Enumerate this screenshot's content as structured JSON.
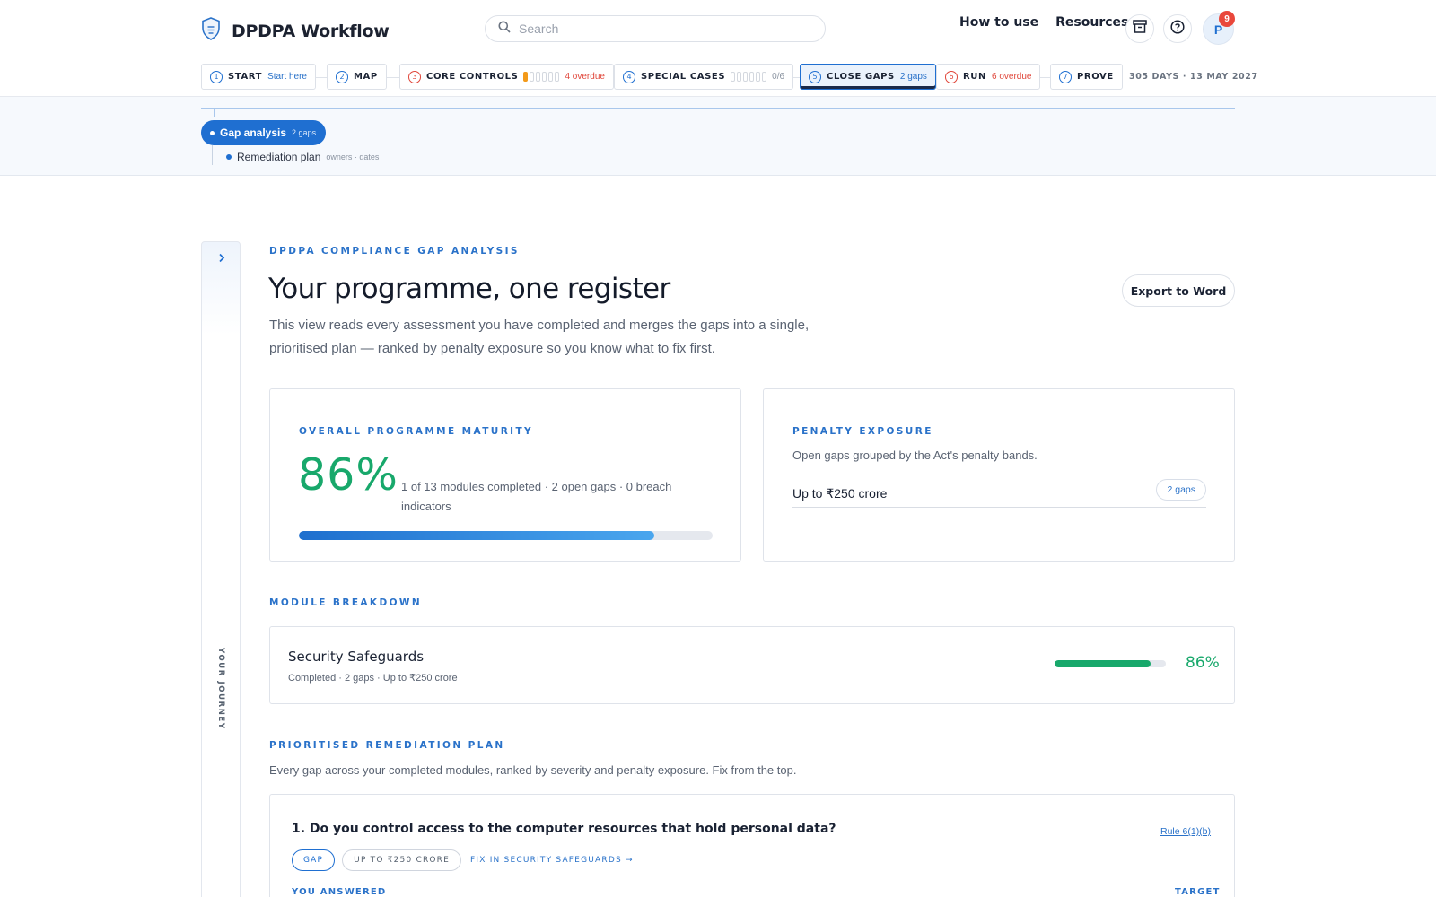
{
  "app": {
    "title": "DPDPA Workflow"
  },
  "search": {
    "placeholder": "Search"
  },
  "nav": {
    "how_to_use": "How to use",
    "resources": "Resources",
    "avatar_initial": "P",
    "notification_count": "9"
  },
  "stepper": {
    "steps": [
      {
        "num": "1",
        "title": "START",
        "sub": "Start here"
      },
      {
        "num": "2",
        "title": "MAP",
        "sub": ""
      },
      {
        "num": "3",
        "title": "CORE CONTROLS",
        "sub": "4 overdue",
        "progress_on": 1,
        "progress_total": 6
      },
      {
        "num": "4",
        "title": "SPECIAL CASES",
        "sub": "0/6",
        "progress_on": 0,
        "progress_total": 6
      },
      {
        "num": "5",
        "title": "CLOSE GAPS",
        "sub": "2 gaps"
      },
      {
        "num": "6",
        "title": "RUN",
        "sub": "6 overdue"
      },
      {
        "num": "7",
        "title": "PROVE",
        "sub": ""
      }
    ],
    "countdown": "305 DAYS · 13 MAY 2027"
  },
  "subnav": {
    "active": {
      "label": "Gap analysis",
      "count": "2 gaps"
    },
    "child": {
      "label": "Remediation plan",
      "meta": "owners · dates"
    }
  },
  "rail": {
    "label": "YOUR JOURNEY"
  },
  "main": {
    "kicker": "DPDPA COMPLIANCE GAP ANALYSIS",
    "title": "Your programme, one register",
    "intro": "This view reads every assessment you have completed and merges the gaps into a single, prioritised plan — ranked by penalty exposure so you know what to fix first.",
    "export_label": "Export to Word"
  },
  "maturity": {
    "heading": "OVERALL PROGRAMME MATURITY",
    "percent_text": "86%",
    "percent_value": 86,
    "note": "1 of 13 modules completed · 2 open gaps · 0 breach indicators"
  },
  "penalty": {
    "heading": "PENALTY EXPOSURE",
    "description": "Open gaps grouped by the Act's penalty bands.",
    "bands": [
      {
        "label": "Up to ₹250 crore",
        "count": "2 gaps"
      }
    ]
  },
  "modules": {
    "heading": "MODULE BREAKDOWN",
    "items": [
      {
        "name": "Security Safeguards",
        "meta": "Completed · 2 gaps · Up to ₹250 crore",
        "percent_text": "86%",
        "percent_value": 86
      }
    ]
  },
  "plan": {
    "heading": "PRIORITISED REMEDIATION PLAN",
    "description": "Every gap across your completed modules, ranked by severity and penalty exposure. Fix from the top.",
    "items": [
      {
        "question": "1. Do you control access to the computer resources that hold personal data?",
        "rule": "Rule 6(1)(b)",
        "tag_gap": "GAP",
        "tag_band": "UP TO ₹250 CRORE",
        "fix_link": "FIX IN SECURITY SAFEGUARDS →",
        "col_you": "YOU ANSWERED",
        "col_target": "TARGET"
      }
    ]
  },
  "colors": {
    "accent": "#1f6fd1",
    "success": "#18a86b",
    "warning": "#f39a1a",
    "danger": "#e0463a"
  }
}
